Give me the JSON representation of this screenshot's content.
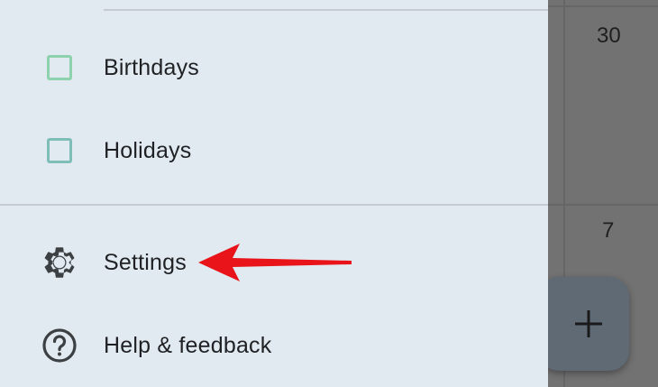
{
  "calendar": {
    "dates": [
      "30",
      "7"
    ]
  },
  "drawer": {
    "calendars": [
      {
        "label": "Birthdays",
        "color": "#8ed1ad",
        "icon": "checkbox-unchecked"
      },
      {
        "label": "Holidays",
        "color": "#7fbdb8",
        "icon": "checkbox-unchecked"
      }
    ],
    "menu": [
      {
        "label": "Settings",
        "icon": "gear-icon"
      },
      {
        "label": "Help & feedback",
        "icon": "help-circle-icon"
      }
    ]
  },
  "fab": {
    "icon": "plus-icon"
  },
  "annotation": {
    "color": "#e8141a",
    "icon": "red-arrow"
  }
}
